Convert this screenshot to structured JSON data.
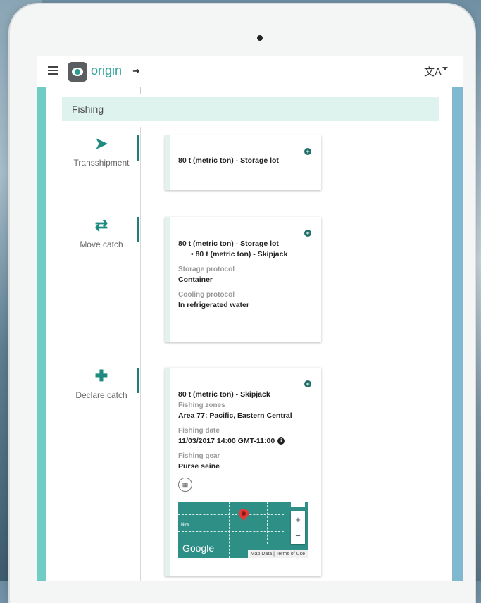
{
  "appbar": {
    "brand": "origin",
    "menu_icon": "hamburger-menu-icon",
    "login_icon": "sign-in-icon",
    "translate_icon": "translate-icon"
  },
  "section": {
    "title": "Fishing"
  },
  "events": [
    {
      "label": "Transshipment",
      "icon": "paper-plane-icon"
    },
    {
      "label": "Move catch",
      "icon": "swap-arrows-icon"
    },
    {
      "label": "Declare catch",
      "icon": "plus-icon"
    }
  ],
  "cards": {
    "transshipment": {
      "title": "80 t (metric ton) - Storage lot"
    },
    "move": {
      "title": "80 t (metric ton) - Storage lot",
      "bullet": "80 t (metric ton) - Skipjack",
      "storage_label": "Storage protocol",
      "storage_value": "Container",
      "cooling_label": "Cooling protocol",
      "cooling_value": "In refrigerated water"
    },
    "declare": {
      "title": "80 t (metric ton) - Skipjack",
      "zones_label": "Fishing zones",
      "zones_value": "Area 77: Pacific, Eastern Central",
      "date_label": "Fishing date",
      "date_value": "11/03/2017 14:00 GMT-11:00",
      "gear_label": "Fishing gear",
      "gear_value": "Purse seine"
    }
  },
  "map": {
    "google": "Google",
    "footer_data": "Map Data",
    "footer_terms": "Terms of Use",
    "zoom_in": "+",
    "zoom_out": "−",
    "small_label": "New"
  },
  "colors": {
    "accent": "#2fa39a",
    "teal_dark": "#1f7f76",
    "header_bg": "#dff3ee"
  }
}
